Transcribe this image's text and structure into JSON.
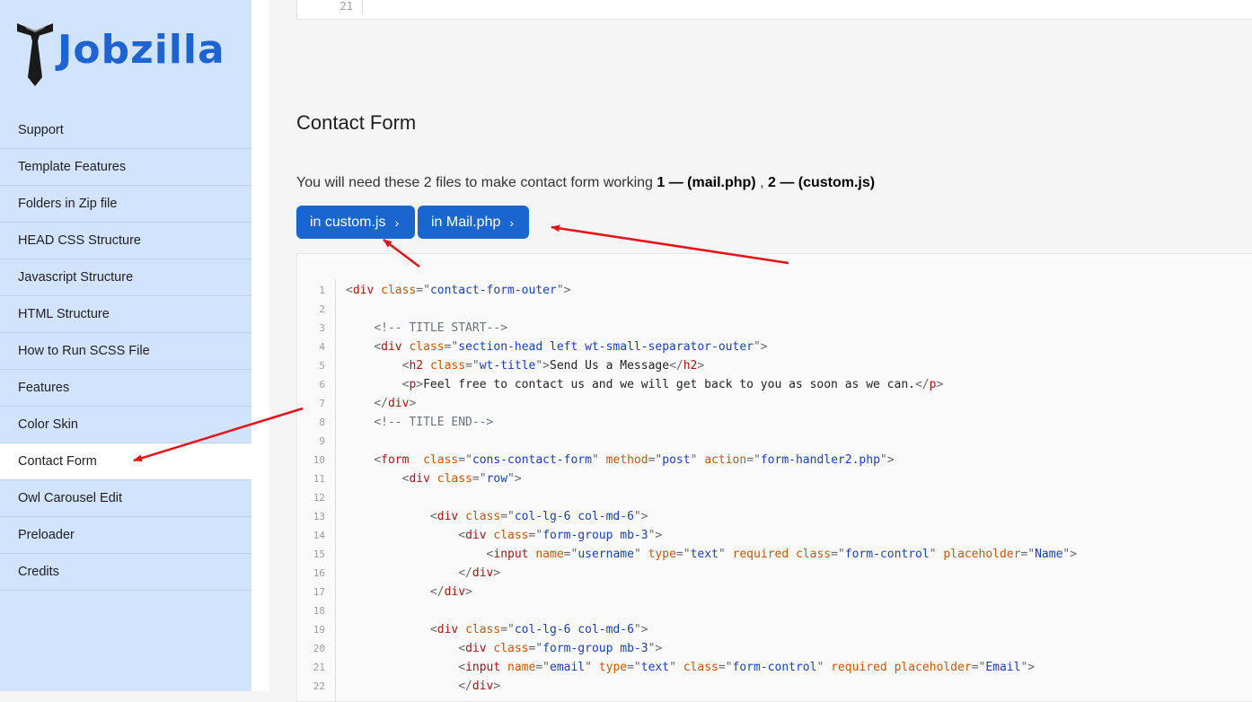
{
  "sidebar": {
    "logo_text": "Jobzilla",
    "items": [
      {
        "label": "Support",
        "active": false
      },
      {
        "label": "Template Features",
        "active": false
      },
      {
        "label": "Folders in Zip file",
        "active": false
      },
      {
        "label": "HEAD CSS Structure",
        "active": false
      },
      {
        "label": "Javascript Structure",
        "active": false
      },
      {
        "label": "HTML Structure",
        "active": false
      },
      {
        "label": "How to Run SCSS File",
        "active": false
      },
      {
        "label": "Features",
        "active": false
      },
      {
        "label": "Color Skin",
        "active": false
      },
      {
        "label": "Contact Form",
        "active": true
      },
      {
        "label": "Owl Carousel Edit",
        "active": false
      },
      {
        "label": "Preloader",
        "active": false
      },
      {
        "label": "Credits",
        "active": false
      }
    ]
  },
  "top_code": {
    "line_number": "21"
  },
  "main": {
    "title": "Contact Form",
    "intro_text": "You will need these 2 files to make contact form working ",
    "intro_file1": "1 — (mail.php)",
    "intro_sep": " , ",
    "intro_file2": "2 — (custom.js)",
    "buttons": [
      {
        "label": "in custom.js",
        "chevron": "›"
      },
      {
        "label": "in Mail.php",
        "chevron": "›"
      }
    ]
  },
  "code_lines": [
    {
      "n": "1",
      "tokens": [
        [
          "p",
          "<"
        ],
        [
          "t",
          "div"
        ],
        [
          "s",
          " "
        ],
        [
          "a",
          "class"
        ],
        [
          "p",
          "=\""
        ],
        [
          "v",
          "contact-form-outer"
        ],
        [
          "p",
          "\">"
        ]
      ]
    },
    {
      "n": "2",
      "tokens": []
    },
    {
      "n": "3",
      "tokens": [
        [
          "s",
          "    "
        ],
        [
          "c",
          "<!-- TITLE START-->"
        ]
      ]
    },
    {
      "n": "4",
      "tokens": [
        [
          "s",
          "    "
        ],
        [
          "p",
          "<"
        ],
        [
          "t",
          "div"
        ],
        [
          "s",
          " "
        ],
        [
          "a",
          "class"
        ],
        [
          "p",
          "=\""
        ],
        [
          "v",
          "section-head left wt-small-separator-outer"
        ],
        [
          "p",
          "\">"
        ]
      ]
    },
    {
      "n": "5",
      "tokens": [
        [
          "s",
          "        "
        ],
        [
          "p",
          "<"
        ],
        [
          "t",
          "h2"
        ],
        [
          "s",
          " "
        ],
        [
          "a",
          "class"
        ],
        [
          "p",
          "=\""
        ],
        [
          "v",
          "wt-title"
        ],
        [
          "p",
          "\">"
        ],
        [
          "s",
          "Send Us a Message"
        ],
        [
          "p",
          "</"
        ],
        [
          "t",
          "h2"
        ],
        [
          "p",
          ">"
        ]
      ]
    },
    {
      "n": "6",
      "tokens": [
        [
          "s",
          "        "
        ],
        [
          "p",
          "<"
        ],
        [
          "t",
          "p"
        ],
        [
          "p",
          ">"
        ],
        [
          "s",
          "Feel free to contact us and we will get back to you as soon as we can."
        ],
        [
          "p",
          "</"
        ],
        [
          "t",
          "p"
        ],
        [
          "p",
          ">"
        ]
      ]
    },
    {
      "n": "7",
      "tokens": [
        [
          "s",
          "    "
        ],
        [
          "p",
          "</"
        ],
        [
          "t",
          "div"
        ],
        [
          "p",
          ">"
        ]
      ]
    },
    {
      "n": "8",
      "tokens": [
        [
          "s",
          "    "
        ],
        [
          "c",
          "<!-- TITLE END-->"
        ]
      ]
    },
    {
      "n": "9",
      "tokens": []
    },
    {
      "n": "10",
      "tokens": [
        [
          "s",
          "    "
        ],
        [
          "p",
          "<"
        ],
        [
          "t",
          "form"
        ],
        [
          "s",
          "  "
        ],
        [
          "a",
          "class"
        ],
        [
          "p",
          "=\""
        ],
        [
          "v",
          "cons-contact-form"
        ],
        [
          "p",
          "\""
        ],
        [
          "s",
          " "
        ],
        [
          "a",
          "method"
        ],
        [
          "p",
          "=\""
        ],
        [
          "v",
          "post"
        ],
        [
          "p",
          "\""
        ],
        [
          "s",
          " "
        ],
        [
          "a",
          "action"
        ],
        [
          "p",
          "=\""
        ],
        [
          "v",
          "form-handler2.php"
        ],
        [
          "p",
          "\">"
        ]
      ]
    },
    {
      "n": "11",
      "tokens": [
        [
          "s",
          "        "
        ],
        [
          "p",
          "<"
        ],
        [
          "t",
          "div"
        ],
        [
          "s",
          " "
        ],
        [
          "a",
          "class"
        ],
        [
          "p",
          "=\""
        ],
        [
          "v",
          "row"
        ],
        [
          "p",
          "\">"
        ]
      ]
    },
    {
      "n": "12",
      "tokens": []
    },
    {
      "n": "13",
      "tokens": [
        [
          "s",
          "            "
        ],
        [
          "p",
          "<"
        ],
        [
          "t",
          "div"
        ],
        [
          "s",
          " "
        ],
        [
          "a",
          "class"
        ],
        [
          "p",
          "=\""
        ],
        [
          "v",
          "col-lg-6 col-md-6"
        ],
        [
          "p",
          "\">"
        ]
      ]
    },
    {
      "n": "14",
      "tokens": [
        [
          "s",
          "                "
        ],
        [
          "p",
          "<"
        ],
        [
          "t",
          "div"
        ],
        [
          "s",
          " "
        ],
        [
          "a",
          "class"
        ],
        [
          "p",
          "=\""
        ],
        [
          "v",
          "form-group mb-3"
        ],
        [
          "p",
          "\">"
        ]
      ]
    },
    {
      "n": "15",
      "tokens": [
        [
          "s",
          "                    "
        ],
        [
          "p",
          "<"
        ],
        [
          "t",
          "input"
        ],
        [
          "s",
          " "
        ],
        [
          "a",
          "name"
        ],
        [
          "p",
          "=\""
        ],
        [
          "v",
          "username"
        ],
        [
          "p",
          "\""
        ],
        [
          "s",
          " "
        ],
        [
          "a",
          "type"
        ],
        [
          "p",
          "=\""
        ],
        [
          "v",
          "text"
        ],
        [
          "p",
          "\""
        ],
        [
          "s",
          " "
        ],
        [
          "a",
          "required"
        ],
        [
          "s",
          " "
        ],
        [
          "a",
          "class"
        ],
        [
          "p",
          "=\""
        ],
        [
          "v",
          "form-control"
        ],
        [
          "p",
          "\""
        ],
        [
          "s",
          " "
        ],
        [
          "a",
          "placeholder"
        ],
        [
          "p",
          "=\""
        ],
        [
          "v",
          "Name"
        ],
        [
          "p",
          "\">"
        ]
      ]
    },
    {
      "n": "16",
      "tokens": [
        [
          "s",
          "                "
        ],
        [
          "p",
          "</"
        ],
        [
          "t",
          "div"
        ],
        [
          "p",
          ">"
        ]
      ]
    },
    {
      "n": "17",
      "tokens": [
        [
          "s",
          "            "
        ],
        [
          "p",
          "</"
        ],
        [
          "t",
          "div"
        ],
        [
          "p",
          ">"
        ]
      ]
    },
    {
      "n": "18",
      "tokens": []
    },
    {
      "n": "19",
      "tokens": [
        [
          "s",
          "            "
        ],
        [
          "p",
          "<"
        ],
        [
          "t",
          "div"
        ],
        [
          "s",
          " "
        ],
        [
          "a",
          "class"
        ],
        [
          "p",
          "=\""
        ],
        [
          "v",
          "col-lg-6 col-md-6"
        ],
        [
          "p",
          "\">"
        ]
      ]
    },
    {
      "n": "20",
      "tokens": [
        [
          "s",
          "                "
        ],
        [
          "p",
          "<"
        ],
        [
          "t",
          "div"
        ],
        [
          "s",
          " "
        ],
        [
          "a",
          "class"
        ],
        [
          "p",
          "=\""
        ],
        [
          "v",
          "form-group mb-3"
        ],
        [
          "p",
          "\">"
        ]
      ]
    },
    {
      "n": "21",
      "tokens": [
        [
          "s",
          "                "
        ],
        [
          "p",
          "<"
        ],
        [
          "t",
          "input"
        ],
        [
          "s",
          " "
        ],
        [
          "a",
          "name"
        ],
        [
          "p",
          "=\""
        ],
        [
          "v",
          "email"
        ],
        [
          "p",
          "\""
        ],
        [
          "s",
          " "
        ],
        [
          "a",
          "type"
        ],
        [
          "p",
          "=\""
        ],
        [
          "v",
          "text"
        ],
        [
          "p",
          "\""
        ],
        [
          "s",
          " "
        ],
        [
          "a",
          "class"
        ],
        [
          "p",
          "=\""
        ],
        [
          "v",
          "form-control"
        ],
        [
          "p",
          "\""
        ],
        [
          "s",
          " "
        ],
        [
          "a",
          "required"
        ],
        [
          "s",
          " "
        ],
        [
          "a",
          "placeholder"
        ],
        [
          "p",
          "=\""
        ],
        [
          "v",
          "Email"
        ],
        [
          "p",
          "\">"
        ]
      ]
    },
    {
      "n": "22",
      "tokens": [
        [
          "s",
          "                "
        ],
        [
          "p",
          "</"
        ],
        [
          "t",
          "div"
        ],
        [
          "p",
          ">"
        ]
      ]
    }
  ],
  "colors": {
    "sidebar_bg": "#d2e3fd",
    "brand_blue": "#1d63d2",
    "button_blue": "#1a66d1",
    "annotation_arrow": "#e3151a"
  }
}
